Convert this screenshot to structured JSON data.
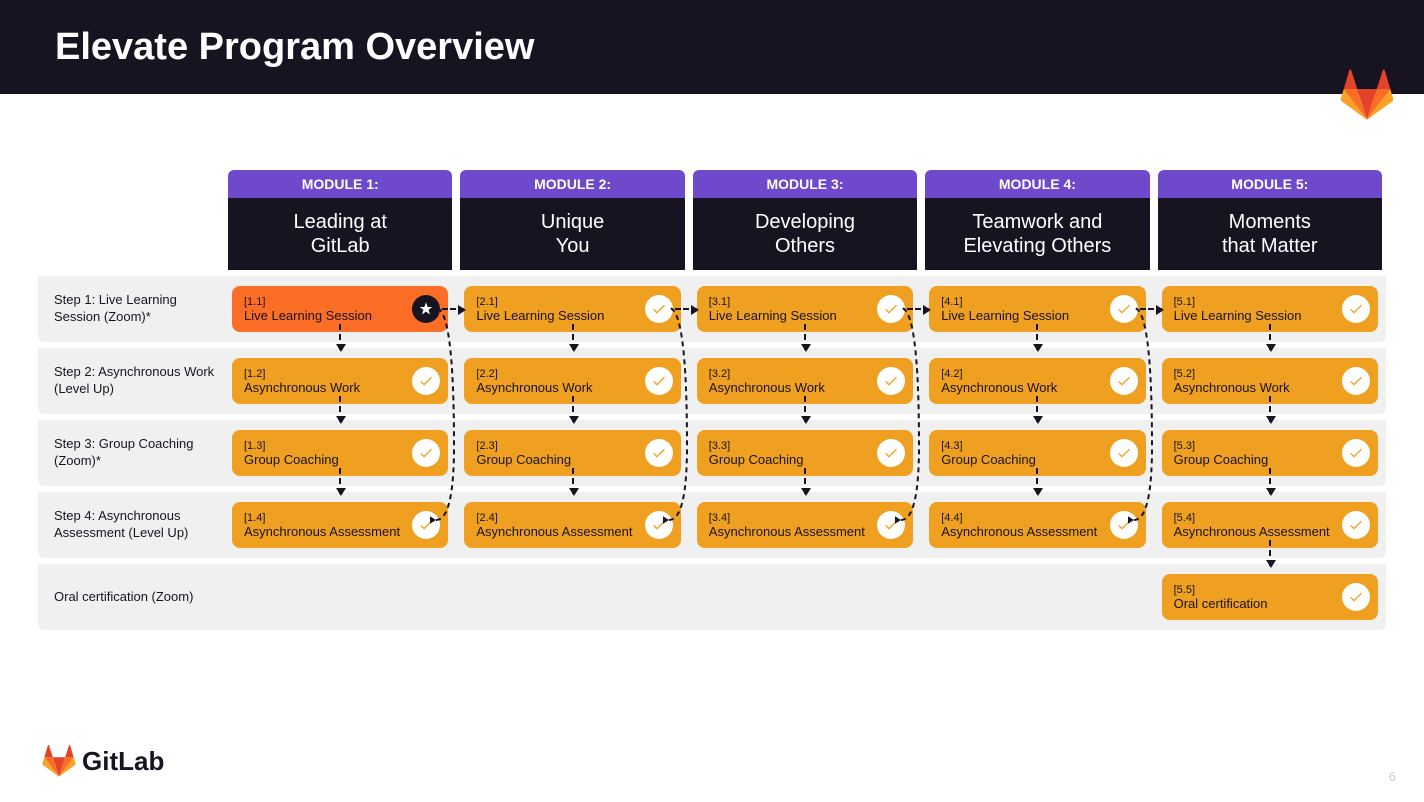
{
  "title": "Elevate Program Overview",
  "page_number": "6",
  "brand": "GitLab",
  "modules": [
    {
      "label": "MODULE 1:",
      "title": "Leading at\nGitLab"
    },
    {
      "label": "MODULE 2:",
      "title": "Unique\nYou"
    },
    {
      "label": "MODULE 3:",
      "title": "Developing\nOthers"
    },
    {
      "label": "MODULE 4:",
      "title": "Teamwork and\nElevating Others"
    },
    {
      "label": "MODULE 5:",
      "title": "Moments\nthat Matter"
    }
  ],
  "steps": [
    {
      "label": "Step 1: Live Learning Session (Zoom)*"
    },
    {
      "label": "Step 2: Asynchronous Work (Level Up)"
    },
    {
      "label": "Step 3: Group Coaching (Zoom)*"
    },
    {
      "label": "Step 4: Asynchronous Assessment (Level Up)"
    },
    {
      "label": "Oral certification (Zoom)"
    }
  ],
  "cells": {
    "r0": [
      {
        "code": "[1.1]",
        "label": "Live Learning Session",
        "active": true,
        "badge": "star",
        "arrow_down": true,
        "arrow_right": true
      },
      {
        "code": "[2.1]",
        "label": "Live Learning Session",
        "active": false,
        "badge": "check",
        "arrow_down": true,
        "arrow_right": true
      },
      {
        "code": "[3.1]",
        "label": "Live Learning Session",
        "active": false,
        "badge": "check",
        "arrow_down": true,
        "arrow_right": true
      },
      {
        "code": "[4.1]",
        "label": "Live Learning Session",
        "active": false,
        "badge": "check",
        "arrow_down": true,
        "arrow_right": true
      },
      {
        "code": "[5.1]",
        "label": "Live Learning Session",
        "active": false,
        "badge": "check",
        "arrow_down": true,
        "arrow_right": false
      }
    ],
    "r1": [
      {
        "code": "[1.2]",
        "label": "Asynchronous Work",
        "active": false,
        "badge": "check",
        "arrow_down": true
      },
      {
        "code": "[2.2]",
        "label": "Asynchronous Work",
        "active": false,
        "badge": "check",
        "arrow_down": true
      },
      {
        "code": "[3.2]",
        "label": "Asynchronous Work",
        "active": false,
        "badge": "check",
        "arrow_down": true
      },
      {
        "code": "[4.2]",
        "label": "Asynchronous Work",
        "active": false,
        "badge": "check",
        "arrow_down": true
      },
      {
        "code": "[5.2]",
        "label": "Asynchronous Work",
        "active": false,
        "badge": "check",
        "arrow_down": true
      }
    ],
    "r2": [
      {
        "code": "[1.3]",
        "label": "Group Coaching",
        "active": false,
        "badge": "check",
        "arrow_down": true
      },
      {
        "code": "[2.3]",
        "label": "Group Coaching",
        "active": false,
        "badge": "check",
        "arrow_down": true
      },
      {
        "code": "[3.3]",
        "label": "Group Coaching",
        "active": false,
        "badge": "check",
        "arrow_down": true
      },
      {
        "code": "[4.3]",
        "label": "Group Coaching",
        "active": false,
        "badge": "check",
        "arrow_down": true
      },
      {
        "code": "[5.3]",
        "label": "Group Coaching",
        "active": false,
        "badge": "check",
        "arrow_down": true
      }
    ],
    "r3": [
      {
        "code": "[1.4]",
        "label": "Asynchronous Assessment",
        "active": false,
        "badge": "check",
        "curve_right": true
      },
      {
        "code": "[2.4]",
        "label": "Asynchronous Assessment",
        "active": false,
        "badge": "check",
        "curve_right": true
      },
      {
        "code": "[3.4]",
        "label": "Asynchronous Assessment",
        "active": false,
        "badge": "check",
        "curve_right": true
      },
      {
        "code": "[4.4]",
        "label": "Asynchronous Assessment",
        "active": false,
        "badge": "check",
        "curve_right": true
      },
      {
        "code": "[5.4]",
        "label": "Asynchronous Assessment",
        "active": false,
        "badge": "check",
        "arrow_down": true
      }
    ],
    "r4": [
      {
        "empty": true
      },
      {
        "empty": true
      },
      {
        "empty": true
      },
      {
        "empty": true
      },
      {
        "code": "[5.5]",
        "label": "Oral certification",
        "active": false,
        "badge": "check"
      }
    ]
  }
}
